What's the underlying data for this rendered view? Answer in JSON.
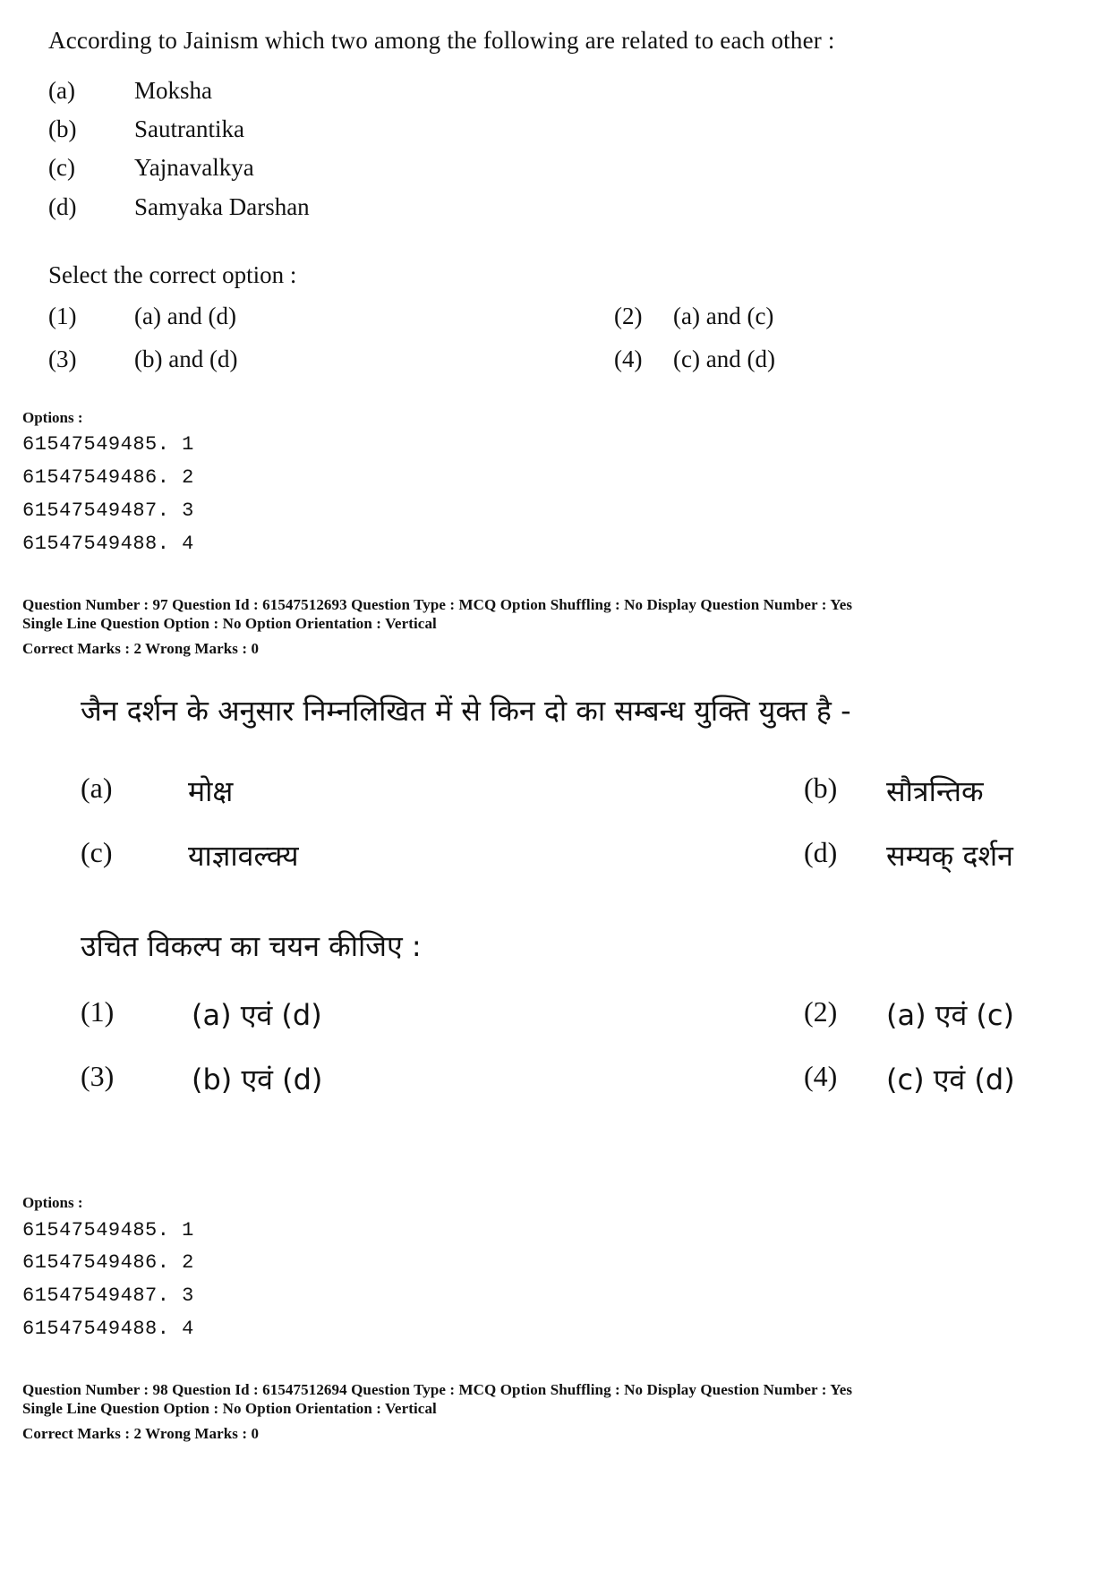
{
  "english_question": {
    "stem": "According to Jainism which two among the following are related to each other :",
    "items": [
      {
        "label": "(a)",
        "text": "Moksha"
      },
      {
        "label": "(b)",
        "text": "Sautrantika"
      },
      {
        "label": "(c)",
        "text": "Yajnavalkya"
      },
      {
        "label": "(d)",
        "text": "Samyaka Darshan"
      }
    ],
    "select_prompt": "Select the correct option :",
    "answers": [
      {
        "label": "(1)",
        "text": "(a) and (d)"
      },
      {
        "label": "(2)",
        "text": "(a) and (c)"
      },
      {
        "label": "(3)",
        "text": "(b) and (d)"
      },
      {
        "label": "(4)",
        "text": "(c) and (d)"
      }
    ]
  },
  "options_block_1": {
    "heading": "Options :",
    "lines": [
      "61547549485. 1",
      "61547549486. 2",
      "61547549487. 3",
      "61547549488. 4"
    ]
  },
  "meta_q97": {
    "line1": "Question Number : 97  Question Id : 61547512693  Question Type : MCQ  Option Shuffling : No  Display Question Number : Yes",
    "line2": "Single Line Question Option : No  Option Orientation : Vertical",
    "line3": "Correct Marks : 2  Wrong Marks : 0"
  },
  "hindi_question": {
    "stem": "जैन दर्शन के अनुसार निम्नलिखित में से किन दो का सम्बन्ध युक्ति युक्त है -",
    "items": [
      {
        "label": "(a)",
        "text": "मोक्ष"
      },
      {
        "label": "(b)",
        "text": "सौत्रन्तिक"
      },
      {
        "label": "(c)",
        "text": "याज्ञावल्क्य"
      },
      {
        "label": "(d)",
        "text": "सम्यक् दर्शन"
      }
    ],
    "select_prompt": "उचित विकल्प का चयन कीजिए :",
    "answers": [
      {
        "label": "(1)",
        "text": "(a) एवं (d)"
      },
      {
        "label": "(2)",
        "text": "(a) एवं (c)"
      },
      {
        "label": "(3)",
        "text": "(b) एवं (d)"
      },
      {
        "label": "(4)",
        "text": "(c) एवं (d)"
      }
    ]
  },
  "options_block_2": {
    "heading": "Options :",
    "lines": [
      "61547549485. 1",
      "61547549486. 2",
      "61547549487. 3",
      "61547549488. 4"
    ]
  },
  "meta_q98": {
    "line1": "Question Number : 98  Question Id : 61547512694  Question Type : MCQ  Option Shuffling : No  Display Question Number : Yes",
    "line2": "Single Line Question Option : No  Option Orientation : Vertical",
    "line3": "Correct Marks : 2  Wrong Marks : 0"
  }
}
